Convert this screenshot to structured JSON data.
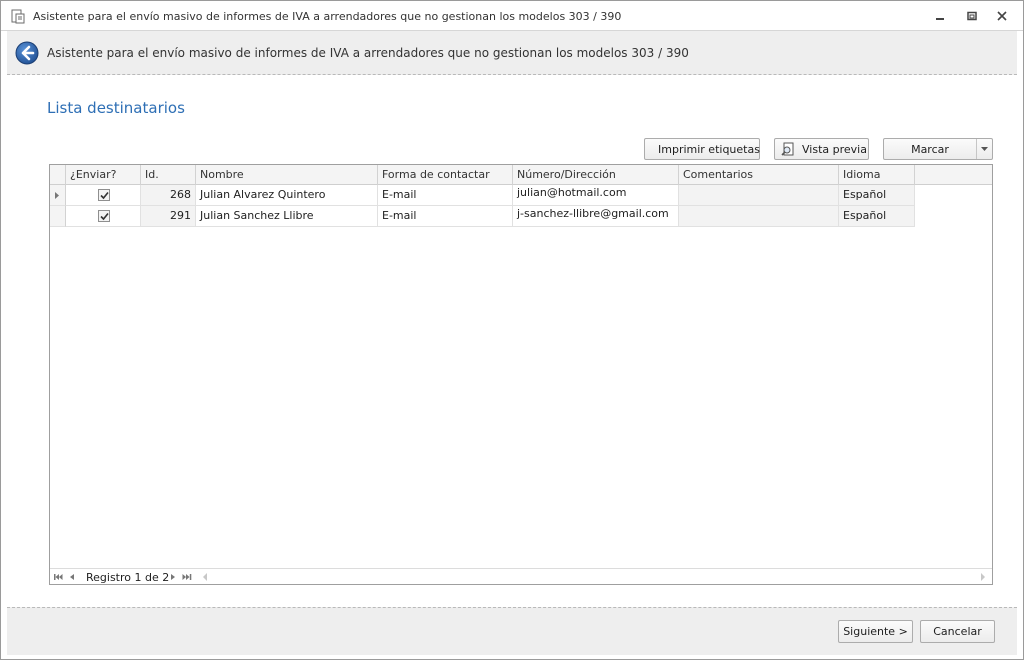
{
  "window": {
    "title": "Asistente para el envío masivo de informes de IVA a arrendadores que no gestionan los modelos 303 / 390"
  },
  "header": {
    "title": "Asistente para el envío masivo de informes de IVA a arrendadores que no gestionan los modelos 303 / 390"
  },
  "section": {
    "title": "Lista destinatarios"
  },
  "toolbar": {
    "print_labels": "Imprimir etiquetas",
    "preview": "Vista previa",
    "mark": "Marcar"
  },
  "grid": {
    "columns": [
      "¿Enviar?",
      "Id.",
      "Nombre",
      "Forma de contactar",
      "Número/Dirección",
      "Comentarios",
      "Idioma"
    ],
    "rows": [
      {
        "send": true,
        "id": "268",
        "name": "Julian Alvarez Quintero",
        "contact": "E-mail",
        "address": "julian@hotmail.com",
        "comments": "",
        "language": "Español"
      },
      {
        "send": true,
        "id": "291",
        "name": "Julian Sanchez Llibre",
        "contact": "E-mail",
        "address": "j-sanchez-llibre@gmail.com",
        "comments": "",
        "language": "Español"
      }
    ],
    "navigator": "Registro 1 de 2"
  },
  "footer": {
    "next": "Siguiente >",
    "cancel": "Cancelar"
  },
  "colors": {
    "accent": "#2e6fb5",
    "back_button": "#2f66b3"
  },
  "icons": [
    "document-icon",
    "minimize-icon",
    "restore-icon",
    "close-icon",
    "back-arrow-icon",
    "print-icon",
    "preview-icon",
    "dropdown-arrow-icon"
  ]
}
